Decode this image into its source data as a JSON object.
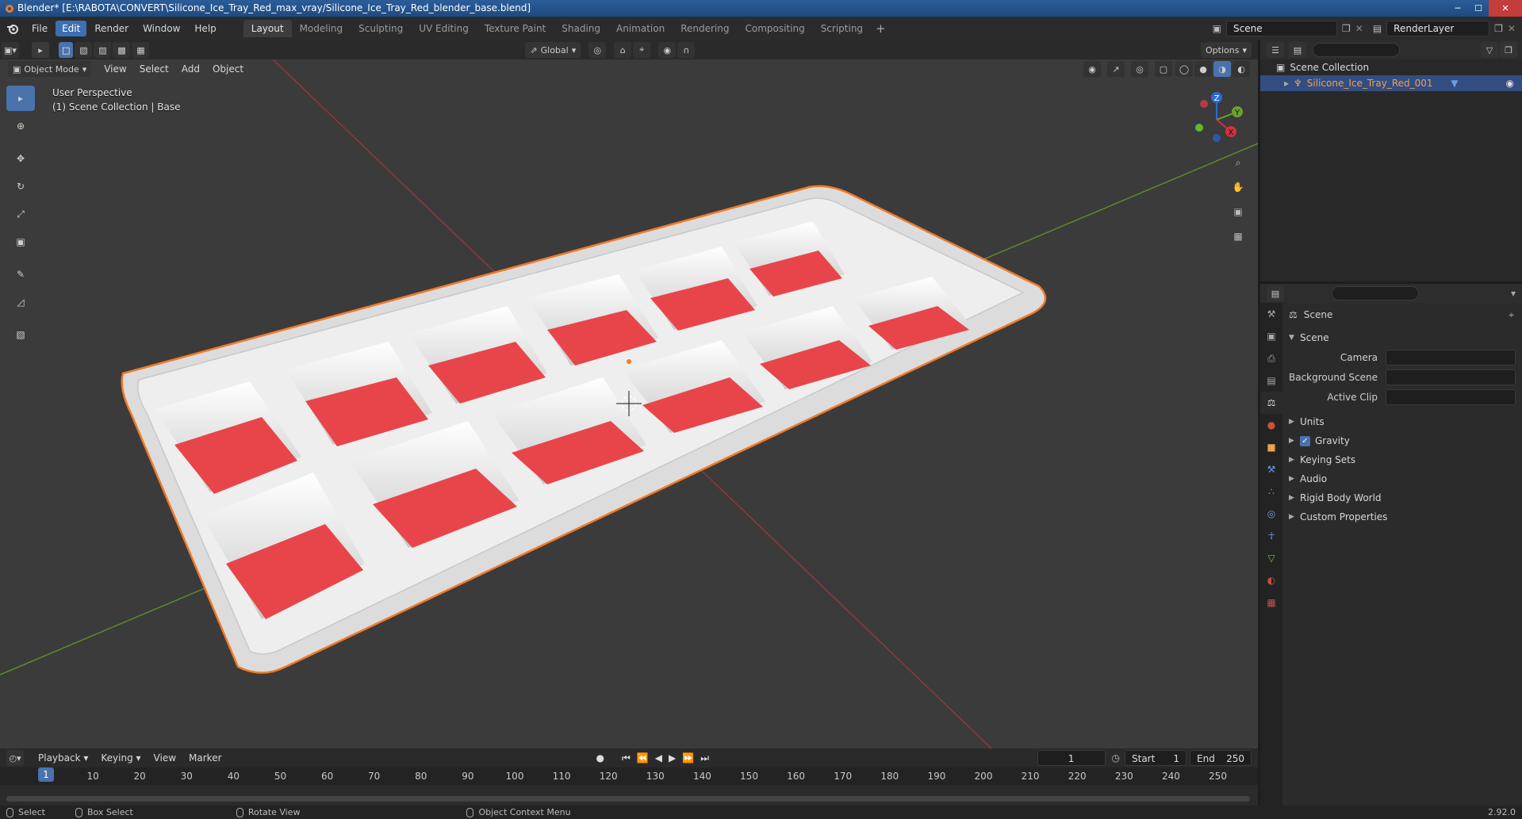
{
  "window": {
    "title": "Blender* [E:\\RABOTA\\CONVERT\\Silicone_Ice_Tray_Red_max_vray/Silicone_Ice_Tray_Red_blender_base.blend]"
  },
  "menu": {
    "file": "File",
    "edit": "Edit",
    "render": "Render",
    "window": "Window",
    "help": "Help"
  },
  "workspaces": [
    "Layout",
    "Modeling",
    "Sculpting",
    "UV Editing",
    "Texture Paint",
    "Shading",
    "Animation",
    "Rendering",
    "Compositing",
    "Scripting"
  ],
  "scene_selector": {
    "scene": "Scene",
    "view_layer": "RenderLayer"
  },
  "header": {
    "orientation": "Global",
    "options": "Options",
    "mode": "Object Mode",
    "view": "View",
    "select": "Select",
    "add": "Add",
    "object": "Object"
  },
  "viewport_info": {
    "perspective": "User Perspective",
    "collection": "(1) Scene Collection | Base"
  },
  "gizmo": {
    "x": "X",
    "y": "Y",
    "z": "Z"
  },
  "outliner": {
    "root": "Scene Collection",
    "object": "Silicone_Ice_Tray_Red_001"
  },
  "properties": {
    "context": "Scene",
    "panel": "Scene",
    "camera_label": "Camera",
    "background_scene_label": "Background Scene",
    "active_clip_label": "Active Clip",
    "subpanels": [
      "Units",
      "Gravity",
      "Keying Sets",
      "Audio",
      "Rigid Body World",
      "Custom Properties"
    ],
    "gravity_checked": true
  },
  "timeline": {
    "playback": "Playback",
    "keying": "Keying",
    "view": "View",
    "marker": "Marker",
    "current_frame": "1",
    "start_label": "Start",
    "start": "1",
    "end_label": "End",
    "end": "250",
    "ticks": [
      "1",
      "10",
      "20",
      "30",
      "40",
      "50",
      "60",
      "70",
      "80",
      "90",
      "100",
      "110",
      "120",
      "130",
      "140",
      "150",
      "160",
      "170",
      "180",
      "190",
      "200",
      "210",
      "220",
      "230",
      "240",
      "250"
    ]
  },
  "statusbar": {
    "select": "Select",
    "box_select": "Box Select",
    "rotate_view": "Rotate View",
    "context_menu": "Object Context Menu",
    "version": "2.92.0"
  },
  "colors": {
    "accent": "#4a72ad",
    "selection_orange": "#f0a050",
    "tray_white": "#e8e8e6",
    "tray_red": "#e23a3e"
  }
}
